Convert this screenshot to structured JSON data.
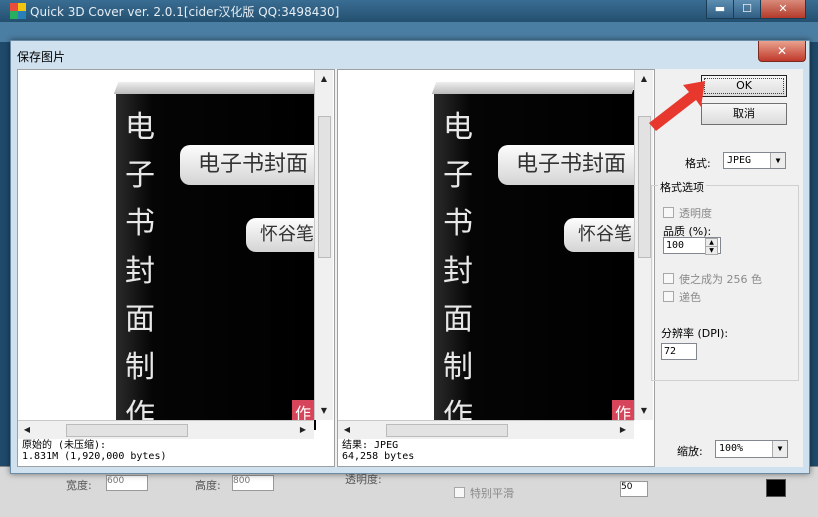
{
  "app": {
    "title": "Quick 3D Cover ver. 2.0.1[cider汉化版 QQ:3498430]",
    "win_min": "▬",
    "win_max": "☐",
    "win_close": "✕"
  },
  "dialog": {
    "title": "保存图片",
    "close": "✕",
    "ok_label": "OK",
    "cancel_label": "取消",
    "format_label": "格式:",
    "format_value": "JPEG",
    "format_options_label": "格式选项",
    "transparency_label": "透明度",
    "quality_label": "品质 (%):",
    "quality_value": "100",
    "make_256_label": "使之成为 256 色",
    "dither_label": "递色",
    "dpi_label": "分辨率 (DPI):",
    "dpi_value": "72",
    "zoom_label": "缩放:",
    "zoom_value": "100%"
  },
  "left_pane": {
    "info_line1": "原始的 (未压缩):",
    "info_line2": "1.831M (1,920,000 bytes)"
  },
  "right_pane": {
    "info_line1": "结果: JPEG",
    "info_line2": "64,258 bytes"
  },
  "cover": {
    "vertical_chars": [
      "电",
      "子",
      "书",
      "封",
      "面",
      "制",
      "作"
    ],
    "ribbon1": "电子书封面",
    "ribbon2": "怀谷笔",
    "corner_tag": "作"
  },
  "background": {
    "width_label": "宽度:",
    "height_label": "高度:",
    "width_value": "600",
    "height_value": "800",
    "transparency_label": "透明度:",
    "smooth_label": "特别平滑",
    "value_50": "50"
  },
  "colors": {
    "accent_red": "#e8382e",
    "dialog_bg": "#cfe0ee",
    "client_bg": "#f0f0f0"
  }
}
